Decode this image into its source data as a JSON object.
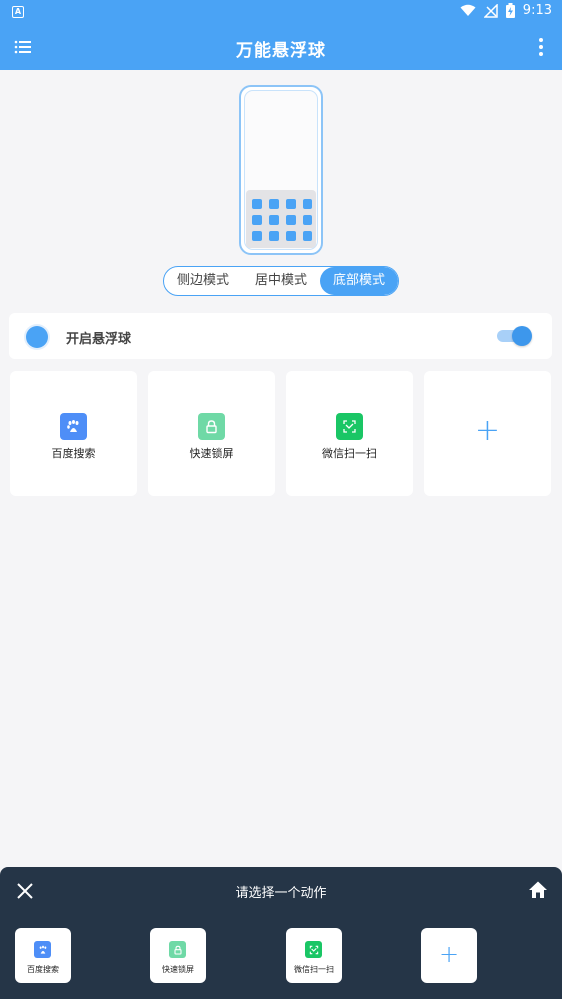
{
  "status_bar": {
    "notification_icon": "a-square-icon",
    "time": "9:13",
    "icons": [
      "wifi-icon",
      "no-signal-icon",
      "battery-charging-icon"
    ]
  },
  "app_bar": {
    "title": "万能悬浮球",
    "left_icon": "menu-list-icon",
    "right_icon": "more-vert-icon",
    "color": "#4aa3f5"
  },
  "mode_selector": {
    "options": [
      "侧边模式",
      "居中模式",
      "底部模式"
    ],
    "selected": "底部模式"
  },
  "toggle": {
    "label": "开启悬浮球",
    "enabled": true
  },
  "actions": [
    {
      "label": "百度搜索",
      "icon": "baidu-paw-icon",
      "color": "#4e8ef7"
    },
    {
      "label": "快速锁屏",
      "icon": "lock-icon",
      "color": "#6fd9a6"
    },
    {
      "label": "微信扫一扫",
      "icon": "scan-icon",
      "color": "#1ac665"
    },
    {
      "label": "+",
      "icon": "add-icon",
      "color": "#4aa3f5"
    }
  ],
  "sheet": {
    "title": "请选择一个动作",
    "left_icon": "close-icon",
    "right_icon": "home-icon",
    "background": "#253547",
    "items": [
      {
        "label": "百度搜索",
        "icon": "baidu-paw-icon"
      },
      {
        "label": "快速锁屏",
        "icon": "lock-icon"
      },
      {
        "label": "微信扫一扫",
        "icon": "scan-icon"
      },
      {
        "label": "+",
        "icon": "add-icon"
      }
    ]
  }
}
